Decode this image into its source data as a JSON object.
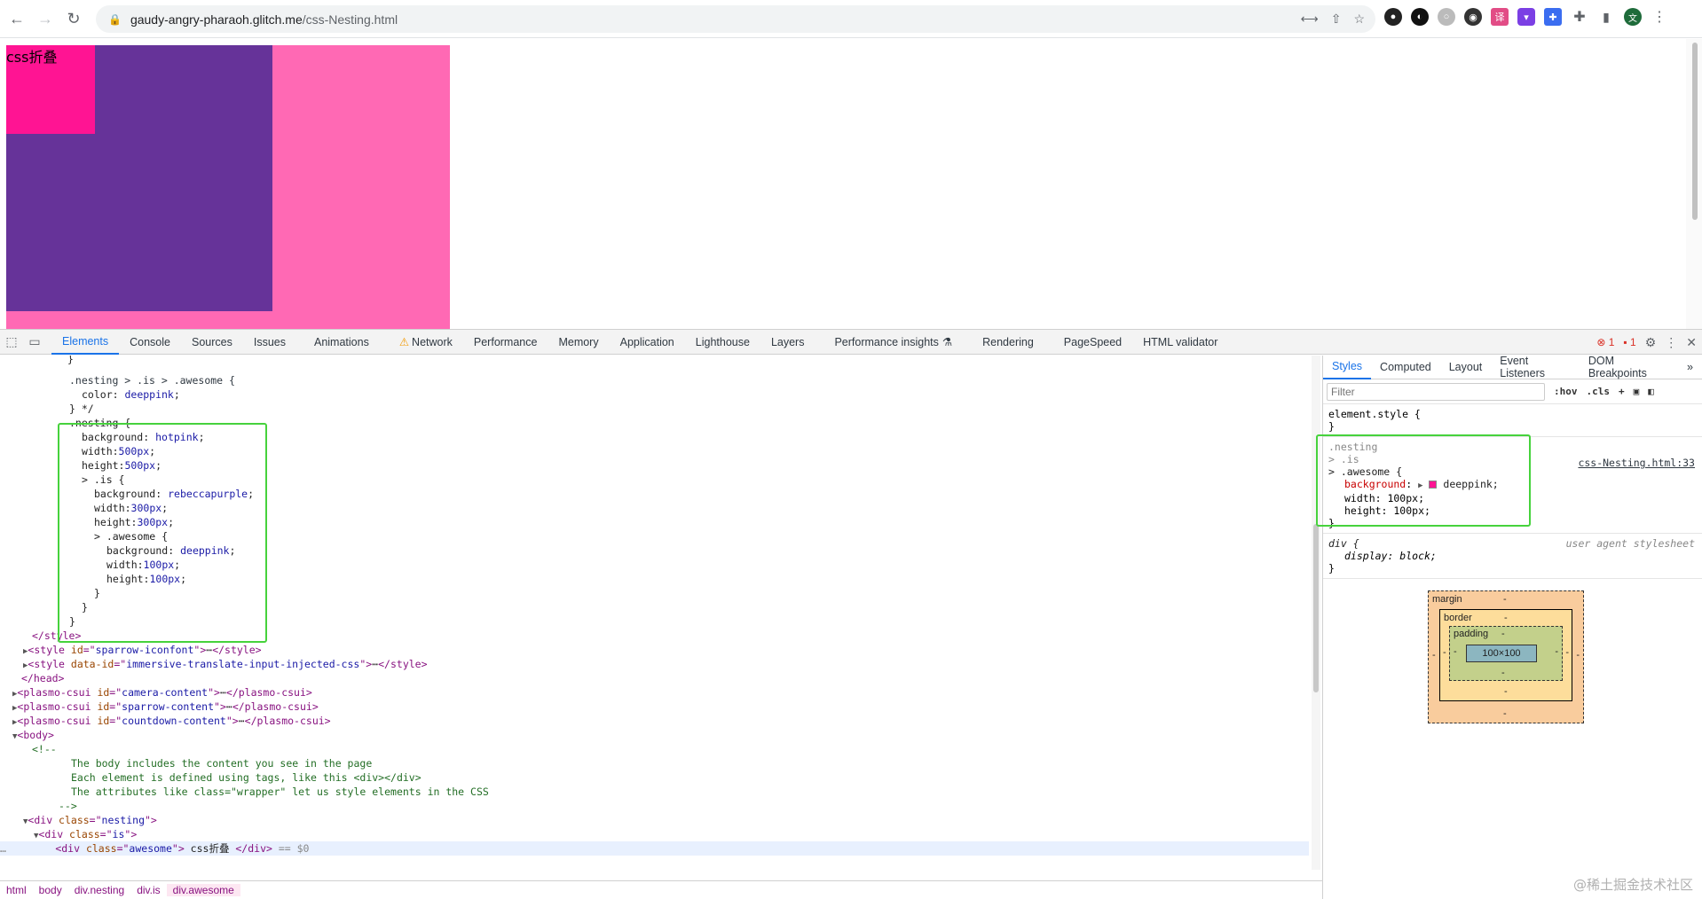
{
  "browser": {
    "url_host": "gaudy-angry-pharaoh.glitch.me",
    "url_path": "/css-Nesting.html",
    "avatar_letter": "文"
  },
  "page": {
    "awesome_text": "css折叠"
  },
  "devtools": {
    "tabs": [
      "Elements",
      "Console",
      "Sources",
      "Issues",
      "Animations",
      "Network",
      "Performance",
      "Memory",
      "Application",
      "Lighthouse",
      "Layers",
      "Performance insights",
      "Rendering",
      "PageSpeed",
      "HTML validator"
    ],
    "error_count": "1",
    "issue_count": "1",
    "breadcrumbs": [
      "html",
      "body",
      "div.nesting",
      "div.is",
      "div.awesome"
    ],
    "styles_tabs": [
      "Styles",
      "Computed",
      "Layout",
      "Event Listeners",
      "DOM Breakpoints"
    ],
    "filter_placeholder": "Filter",
    "hov": ":hov",
    "cls": ".cls",
    "element_style": "element.style {",
    "rule_selector_1": ".nesting",
    "rule_selector_2": "> .is",
    "rule_selector_3": "> .awesome {",
    "rule_source": "css-Nesting.html:33",
    "rule_bg_name": "background",
    "rule_bg_value": "deeppink;",
    "rule_width": "width: 100px;",
    "rule_height": "height: 100px;",
    "ua_selector": "div {",
    "ua_source": "user agent stylesheet",
    "ua_prop": "display: block;",
    "box_margin": "margin",
    "box_border": "border",
    "box_padding": "padding",
    "box_content": "100×100",
    "dash": "-"
  },
  "watermark": "@稀土掘金技术社区"
}
